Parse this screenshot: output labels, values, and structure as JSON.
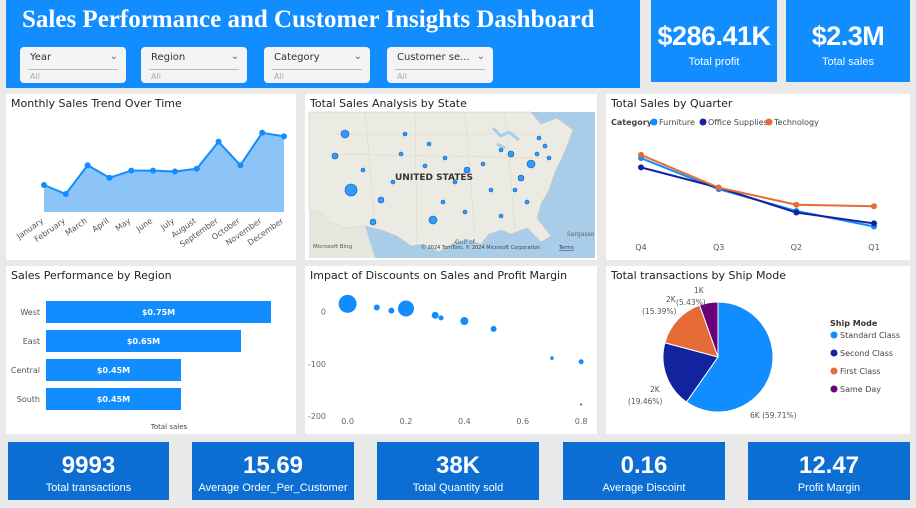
{
  "header": {
    "title": "Sales Performance and Customer Insights Dashboard",
    "slicers": [
      {
        "label": "Year",
        "value": "All"
      },
      {
        "label": "Region",
        "value": "All"
      },
      {
        "label": "Category",
        "value": "All"
      },
      {
        "label": "Customer se...",
        "value": "All"
      }
    ]
  },
  "kpis_top": [
    {
      "value": "$286.41K",
      "label": "Total profit"
    },
    {
      "value": "$2.3M",
      "label": "Total sales"
    }
  ],
  "kpis_bottom": [
    {
      "value": "9993",
      "label": "Total transactions"
    },
    {
      "value": "15.69",
      "label": "Average Order_Per_Customer"
    },
    {
      "value": "38K",
      "label": "Total Quantity sold"
    },
    {
      "value": "0.16",
      "label": "Average Discoint"
    },
    {
      "value": "12.47",
      "label": "Profit Margin"
    }
  ],
  "panels": {
    "monthly": {
      "title": "Monthly Sales Trend Over Time"
    },
    "state": {
      "title": "Total Sales Analysis by State"
    },
    "quarter": {
      "title": "Total Sales by Quarter"
    },
    "region": {
      "title": "Sales Performance by Region"
    },
    "discount": {
      "title": "Impact of Discounts on Sales and Profit Margin"
    },
    "shipmode": {
      "title": "Total transactions by Ship Mode"
    }
  },
  "map": {
    "country_label": "UNITED STATES",
    "attribution": "Microsoft Bing",
    "copyright": "© 2024 TomTom, © 2024 Microsoft Corporation",
    "terms": "Terms",
    "gulf": "Gulf of",
    "sea": "Sargasso"
  },
  "colors": {
    "accent": "#118dff",
    "kpi_bottom": "#0c6ed3",
    "navy": "#12239e",
    "orange": "#e66c37",
    "purple": "#6b007b"
  },
  "chart_data": [
    {
      "type": "area",
      "categories": [
        "January",
        "February",
        "March",
        "April",
        "May",
        "June",
        "July",
        "August",
        "September",
        "October",
        "November",
        "December"
      ],
      "values": [
        30,
        20,
        52,
        38,
        46,
        46,
        45,
        48,
        78,
        52,
        88,
        84
      ],
      "ylim": [
        0,
        100
      ]
    },
    {
      "type": "line",
      "legend_title": "Category",
      "categories": [
        "Q4",
        "Q3",
        "Q2",
        "Q1"
      ],
      "series": [
        {
          "name": "Furniture",
          "values": [
            82,
            62,
            48,
            38
          ]
        },
        {
          "name": "Office Supplies",
          "values": [
            76,
            63,
            47,
            40
          ]
        },
        {
          "name": "Technology",
          "values": [
            84,
            63,
            52,
            51
          ]
        }
      ],
      "ylim": [
        30,
        100
      ]
    },
    {
      "type": "bar",
      "categories": [
        "West",
        "East",
        "Central",
        "South"
      ],
      "values": [
        0.75,
        0.65,
        0.45,
        0.45
      ],
      "labels": [
        "$0.75M",
        "$0.65M",
        "$0.45M",
        "$0.45M"
      ],
      "xlabel": "Total sales",
      "xlim": [
        0,
        0.86
      ]
    },
    {
      "type": "scatter",
      "x_ticks": [
        "0.0",
        "0.2",
        "0.4",
        "0.6",
        "0.8"
      ],
      "y_ticks": [
        "0",
        "-100",
        "-200"
      ],
      "xlim": [
        -0.05,
        0.82
      ],
      "ylim": [
        -200,
        30
      ],
      "points": [
        {
          "x": 0.0,
          "y": 15,
          "r": 9
        },
        {
          "x": 0.1,
          "y": 8,
          "r": 3
        },
        {
          "x": 0.15,
          "y": 2,
          "r": 3
        },
        {
          "x": 0.2,
          "y": 6,
          "r": 8
        },
        {
          "x": 0.3,
          "y": -7,
          "r": 3.5
        },
        {
          "x": 0.32,
          "y": -12,
          "r": 2.5
        },
        {
          "x": 0.4,
          "y": -18,
          "r": 4
        },
        {
          "x": 0.5,
          "y": -33,
          "r": 3
        },
        {
          "x": 0.7,
          "y": -89,
          "r": 1.8
        },
        {
          "x": 0.8,
          "y": -96,
          "r": 2.5
        },
        {
          "x": 0.8,
          "y": -178,
          "r": 1.2
        }
      ]
    },
    {
      "type": "pie",
      "legend_title": "Ship Mode",
      "slices": [
        {
          "name": "Standard Class",
          "value": 59.71,
          "label": "6K (59.71%)"
        },
        {
          "name": "Second Class",
          "value": 19.46,
          "label": "2K\n(19.46%)"
        },
        {
          "name": "First Class",
          "value": 15.39,
          "label": "2K\n(15.39%)"
        },
        {
          "name": "Same Day",
          "value": 5.43,
          "label": "1K\n(5.43%)"
        }
      ],
      "label_1k_top": "1K",
      "label_2k_first": "2K (15.39%)",
      "label_2k_second": "2K (19.46%)"
    }
  ]
}
